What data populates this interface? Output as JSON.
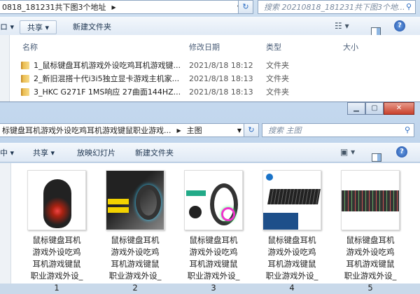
{
  "back_window": {
    "address": "0818_181231共下图3个地址",
    "search_placeholder": "搜索 20210818_181231共下图3个地...",
    "toolbar": {
      "organize_tail": "ロ ▾",
      "share": "共享 ▾",
      "new_folder": "新建文件夹"
    },
    "columns": [
      "名称",
      "修改日期",
      "类型",
      "大小"
    ],
    "rows": [
      {
        "name": "1_鼠标键盘耳机游戏外设吃鸡耳机游戏键...",
        "date": "2021/8/18 18:12",
        "type": "文件夹"
      },
      {
        "name": "2_新旧混搭十代i3i5独立显卡游戏主机家...",
        "date": "2021/8/18 18:13",
        "type": "文件夹"
      },
      {
        "name": "3_HKC G271F 1MS响应 27曲面144HZ...",
        "date": "2021/8/18 18:13",
        "type": "文件夹"
      }
    ]
  },
  "front_window": {
    "address": "标键盘耳机游戏外设吃鸡耳机游戏键鼠职业游戏...",
    "address_current": "主图",
    "search_placeholder": "搜索 主图",
    "toolbar": {
      "organize_tail": "中 ▾",
      "share": "共享 ▾",
      "slideshow": "放映幻灯片",
      "new_folder": "新建文件夹"
    },
    "files": [
      {
        "name": "鼠标键盘耳机游戏外设吃鸡耳机游戏键鼠职业游戏外设_1",
        "kind": "mouse"
      },
      {
        "name": "鼠标键盘耳机游戏外设吃鸡耳机游戏键鼠职业游戏外设_2",
        "kind": "headset-promo"
      },
      {
        "name": "鼠标键盘耳机游戏外设吃鸡耳机游戏键鼠职业游戏外设_3",
        "kind": "headset-rgb"
      },
      {
        "name": "鼠标键盘耳机游戏外设吃鸡耳机游戏键鼠职业游戏外设_4",
        "kind": "keyboard-hp"
      },
      {
        "name": "鼠标键盘耳机游戏外设吃鸡耳机游戏键鼠职业游戏外设_5",
        "kind": "keyboard-rgb"
      }
    ]
  }
}
